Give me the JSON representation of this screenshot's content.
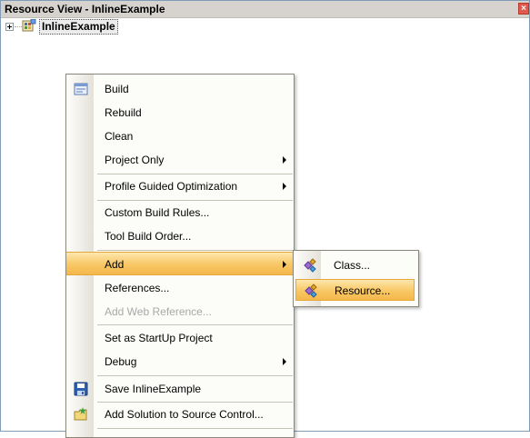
{
  "window": {
    "title": "Resource View - InlineExample",
    "close_glyph": "×"
  },
  "tree": {
    "root_label": "InlineExample"
  },
  "context_menu": {
    "items": [
      {
        "label": "Build",
        "icon": "build-icon"
      },
      {
        "label": "Rebuild"
      },
      {
        "label": "Clean"
      },
      {
        "label": "Project Only",
        "submenu": true
      },
      {
        "label": "Profile Guided Optimization",
        "submenu": true
      },
      {
        "label": "Custom Build Rules..."
      },
      {
        "label": "Tool Build Order..."
      },
      {
        "label": "Add",
        "submenu": true,
        "highlighted": true
      },
      {
        "label": "References..."
      },
      {
        "label": "Add Web Reference...",
        "disabled": true
      },
      {
        "label": "Set as StartUp Project"
      },
      {
        "label": "Debug",
        "submenu": true
      },
      {
        "label": "Save InlineExample",
        "icon": "save-icon"
      },
      {
        "label": "Add Solution to Source Control...",
        "icon": "add-source-control-icon"
      }
    ]
  },
  "add_submenu": {
    "items": [
      {
        "label": "Class...",
        "icon": "class-icon"
      },
      {
        "label": "Resource...",
        "icon": "resource-icon",
        "highlighted": true
      }
    ]
  },
  "colors": {
    "highlight": "#f8c764",
    "highlight_border": "#e5a73a",
    "title_bar": "#d6d3ce"
  }
}
